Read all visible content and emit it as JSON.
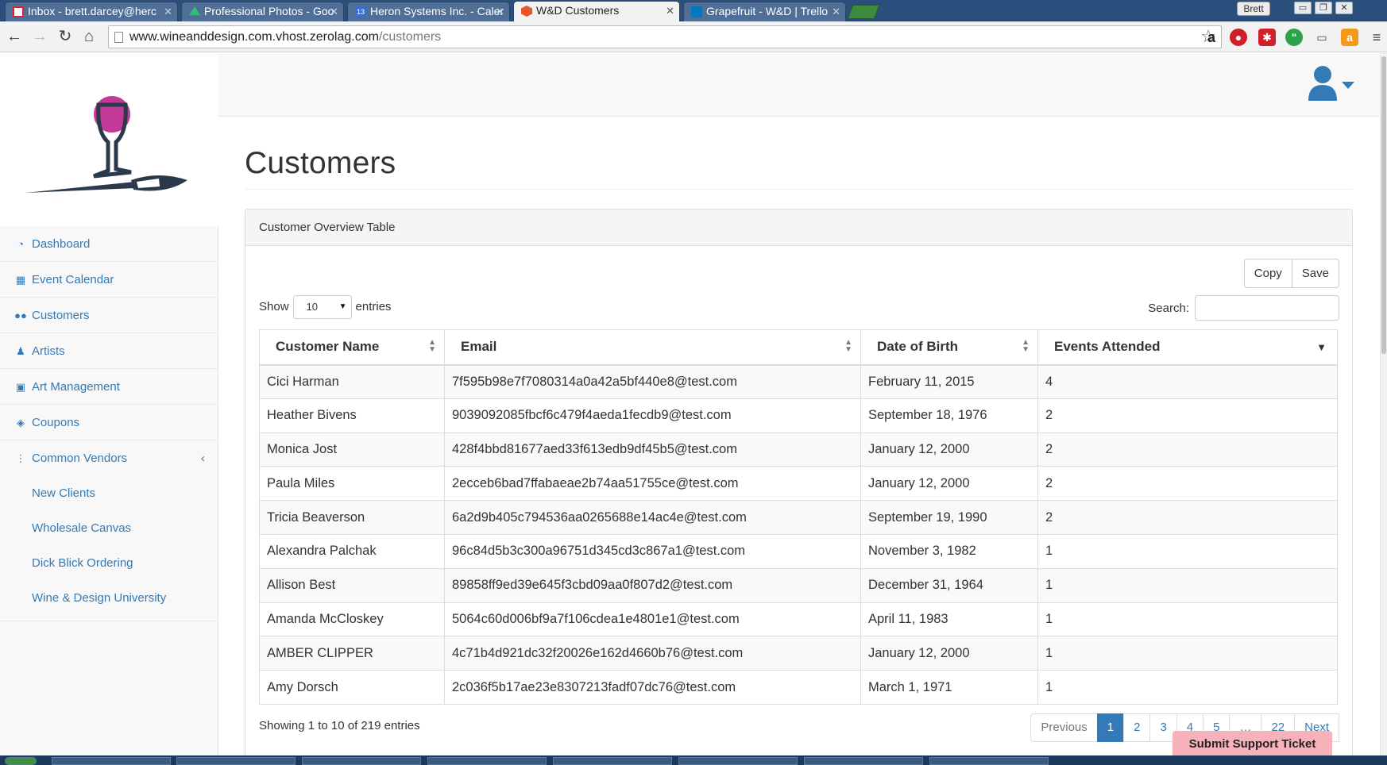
{
  "browser": {
    "tabs": [
      {
        "title": "Inbox - brett.darcey@herc",
        "active": false
      },
      {
        "title": "Professional Photos - Goo",
        "active": false
      },
      {
        "title": "Heron Systems Inc. - Caler",
        "active": false
      },
      {
        "title": "W&D Customers",
        "active": true
      },
      {
        "title": "Grapefruit - W&D | Trello",
        "active": false
      }
    ],
    "user_chip": "Brett",
    "url_host": "www.wineanddesign.com.vhost.zerolag.com",
    "url_path": "/customers"
  },
  "sidebar": {
    "items": [
      {
        "label": "Dashboard",
        "icon": "dashboard-icon"
      },
      {
        "label": "Event Calendar",
        "icon": "calendar-icon"
      },
      {
        "label": "Customers",
        "icon": "users-icon"
      },
      {
        "label": "Artists",
        "icon": "person-icon"
      },
      {
        "label": "Art Management",
        "icon": "image-icon"
      },
      {
        "label": "Coupons",
        "icon": "tag-icon"
      },
      {
        "label": "Common Vendors",
        "icon": "vertical-dots-icon"
      }
    ],
    "subitems": [
      {
        "label": "New Clients"
      },
      {
        "label": "Wholesale Canvas"
      },
      {
        "label": "Dick Blick Ordering"
      },
      {
        "label": "Wine & Design University"
      }
    ]
  },
  "page": {
    "title": "Customers",
    "panel_title": "Customer Overview Table"
  },
  "table_controls": {
    "copy_label": "Copy",
    "save_label": "Save",
    "show_label": "Show",
    "entries_label": "entries",
    "length_value": "10",
    "search_label": "Search:",
    "search_value": ""
  },
  "table": {
    "columns": [
      "Customer Name",
      "Email",
      "Date of Birth",
      "Events Attended"
    ],
    "sorted_column": "Events Attended",
    "sort_direction": "descending",
    "rows": [
      [
        "Cici Harman",
        "7f595b98e7f7080314a0a42a5bf440e8@test.com",
        "February 11, 2015",
        "4"
      ],
      [
        "Heather Bivens",
        "9039092085fbcf6c479f4aeda1fecdb9@test.com",
        "September 18, 1976",
        "2"
      ],
      [
        "Monica Jost",
        "428f4bbd81677aed33f613edb9df45b5@test.com",
        "January 12, 2000",
        "2"
      ],
      [
        "Paula Miles",
        "2ecceb6bad7ffabaeae2b74aa51755ce@test.com",
        "January 12, 2000",
        "2"
      ],
      [
        "Tricia Beaverson",
        "6a2d9b405c794536aa0265688e14ac4e@test.com",
        "September 19, 1990",
        "2"
      ],
      [
        "Alexandra Palchak",
        "96c84d5b3c300a96751d345cd3c867a1@test.com",
        "November 3, 1982",
        "1"
      ],
      [
        "Allison Best",
        "89858ff9ed39e645f3cbd09aa0f807d2@test.com",
        "December 31, 1964",
        "1"
      ],
      [
        "Amanda McCloskey",
        "5064c60d006bf9a7f106cdea1e4801e1@test.com",
        "April 11, 1983",
        "1"
      ],
      [
        "AMBER CLIPPER",
        "4c71b4d921dc32f20026e162d4660b76@test.com",
        "January 12, 2000",
        "1"
      ],
      [
        "Amy Dorsch",
        "2c036f5b17ae23e8307213fadf07dc76@test.com",
        "March 1, 1971",
        "1"
      ]
    ]
  },
  "footer": {
    "info": "Showing 1 to 10 of 219 entries",
    "pagination": [
      "Previous",
      "1",
      "2",
      "3",
      "4",
      "5",
      "…",
      "22",
      "Next"
    ],
    "current_page": "1"
  },
  "support_button": "Submit Support Ticket",
  "colors": {
    "link": "#337ab7",
    "logo_magenta": "#c2399a",
    "logo_dark": "#2b3a4a",
    "support_button": "#f6b1b9"
  }
}
